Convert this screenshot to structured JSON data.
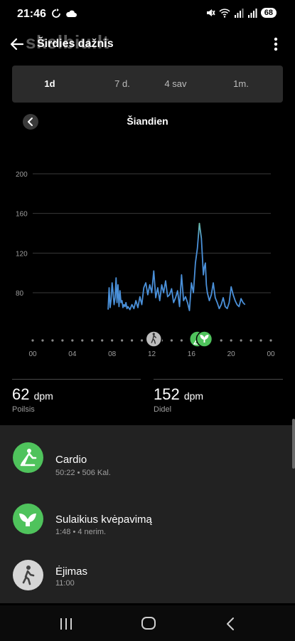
{
  "status": {
    "time": "21:46",
    "battery": "68",
    "left_icons": [
      "sync-icon",
      "cloud-icon"
    ],
    "right_icons": [
      "mute-icon",
      "wifi-icon",
      "signal-icon",
      "signal-icon"
    ]
  },
  "app": {
    "title": "Širdies dažnis",
    "watermark": "skelbiu.lt"
  },
  "tabs": [
    {
      "label": "1d",
      "active": true
    },
    {
      "label": "7 d.",
      "active": false
    },
    {
      "label": "4 sav",
      "active": false
    },
    {
      "label": "1m.",
      "active": false
    }
  ],
  "date": {
    "label": "Šiandien"
  },
  "chart_data": {
    "type": "line",
    "y_ticks": [
      "200",
      "160",
      "120",
      "80"
    ],
    "x_ticks": [
      "00",
      "04",
      "08",
      "12",
      "16",
      "20",
      "00"
    ],
    "ylim": [
      40,
      200
    ],
    "xlim": [
      0,
      24
    ],
    "grid": true,
    "colors": {
      "line": "#4a90d9",
      "peak": "#7fd68b",
      "grid": "#3a3a3a"
    },
    "markers": [
      {
        "hour": 12.2,
        "icon": "walking-icon"
      },
      {
        "hour": 16.6,
        "icon": "cardio-icon"
      },
      {
        "hour": 17.3,
        "icon": "breath-hold-icon"
      }
    ],
    "series": [
      {
        "x": [
          7.6,
          7.7,
          7.8,
          7.9,
          8.0,
          8.1,
          8.2,
          8.3,
          8.4,
          8.5,
          8.6,
          8.7,
          8.8,
          8.9,
          9.0,
          9.1,
          9.2,
          9.3,
          9.4,
          9.5,
          9.6,
          9.8,
          10.0,
          10.2,
          10.4,
          10.6,
          10.8,
          11.0,
          11.2,
          11.4,
          11.6,
          11.8,
          12.0,
          12.2,
          12.4,
          12.6,
          12.8,
          13.0,
          13.2,
          13.4,
          13.6,
          13.8,
          14.0,
          14.2,
          14.4,
          14.6,
          14.8,
          15.0,
          15.2,
          15.4,
          15.6,
          15.8,
          16.0,
          16.2,
          16.4,
          16.6,
          16.8,
          17.0,
          17.2,
          17.3,
          17.4,
          17.5,
          17.6,
          17.8,
          18.0,
          18.2,
          18.4,
          18.6,
          18.8,
          19.0,
          19.2,
          19.4,
          19.6,
          19.8,
          20.0,
          20.2,
          20.4,
          20.6,
          20.8,
          21.0,
          21.2,
          21.4
        ],
        "y": [
          63,
          85,
          65,
          73,
          90,
          80,
          68,
          75,
          95,
          70,
          88,
          66,
          82,
          70,
          72,
          65,
          68,
          66,
          70,
          64,
          66,
          63,
          68,
          64,
          72,
          65,
          76,
          68,
          85,
          90,
          78,
          88,
          80,
          102,
          75,
          85,
          72,
          88,
          80,
          92,
          76,
          78,
          84,
          70,
          75,
          82,
          66,
          98,
          72,
          76,
          70,
          62,
          90,
          80,
          110,
          125,
          150,
          135,
          98,
          106,
          110,
          88,
          80,
          72,
          78,
          90,
          75,
          70,
          64,
          68,
          75,
          66,
          64,
          70,
          86,
          78,
          72,
          68,
          66,
          74,
          70,
          68
        ]
      }
    ]
  },
  "stats": [
    {
      "value": "62",
      "unit": "dpm",
      "label": "Poilsis"
    },
    {
      "value": "152",
      "unit": "dpm",
      "label": "Didel"
    }
  ],
  "activities": [
    {
      "title": "Cardio",
      "sub": "50:22 • 506 Kal.",
      "icon": "cardio-icon",
      "color": "#4fc35c"
    },
    {
      "title": "Sulaikius kvėpavimą",
      "sub": "1:48 • 4 nerim.",
      "icon": "breath-hold-icon",
      "color": "#4fc35c"
    },
    {
      "title": "Ėjimas",
      "sub": "11:00",
      "icon": "walking-icon",
      "color": "#d6d6d6"
    }
  ],
  "nav": [
    "recent-apps-icon",
    "home-icon",
    "back-icon"
  ]
}
